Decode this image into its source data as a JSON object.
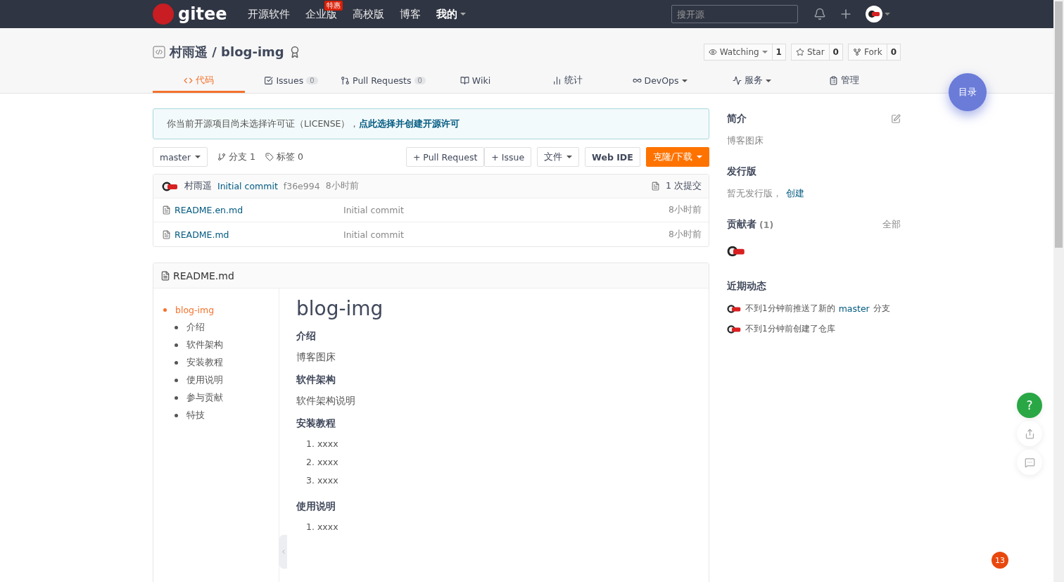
{
  "navbar": {
    "logo": "gitee",
    "links": [
      {
        "label": "开源软件"
      },
      {
        "label": "企业版",
        "badge": "特惠"
      },
      {
        "label": "高校版"
      },
      {
        "label": "博客"
      }
    ],
    "menu": "我的",
    "search": {
      "placeholder": "搜开源"
    }
  },
  "repo": {
    "title": "村雨遥 / blog-img",
    "actions": [
      {
        "label": "Watching",
        "caret": true,
        "count": "1",
        "kind": "watch"
      },
      {
        "label": "Star",
        "caret": false,
        "count": "0",
        "kind": "star"
      },
      {
        "label": "Fork",
        "caret": false,
        "count": "0",
        "kind": "fork"
      }
    ]
  },
  "tabs": [
    {
      "label": "代码",
      "kind": "code",
      "selected": true
    },
    {
      "label": "Issues",
      "count": "0",
      "kind": "issues",
      "selected": false
    },
    {
      "label": "Pull Requests",
      "count": "0",
      "kind": "pr",
      "selected": false
    },
    {
      "label": "Wiki",
      "kind": "wiki",
      "selected": false
    },
    {
      "label": "统计",
      "kind": "stats",
      "selected": false
    },
    {
      "label": "DevOps",
      "kind": "devops",
      "caret": true,
      "selected": false
    },
    {
      "label": "服务",
      "kind": "service",
      "caret": true,
      "selected": false
    },
    {
      "label": "管理",
      "kind": "admin",
      "selected": false
    }
  ],
  "notice": {
    "text": "你当前开源项目尚未选择许可证（LICENSE），",
    "link": "点此选择并创建开源许可"
  },
  "toolbar": {
    "branch": "master",
    "branches": "分支 1",
    "tags": "标签 0",
    "pull_request": "+ Pull Request",
    "issue": "+ Issue",
    "file_menu": "文件",
    "web_ide": "Web IDE",
    "clone": "克隆/下载"
  },
  "commit": {
    "author": "村雨遥",
    "message": "Initial commit",
    "hash": "f36e994",
    "time": "8小时前",
    "count": "1 次提交"
  },
  "files": [
    {
      "name": "README.en.md",
      "message": "Initial commit",
      "time": "8小时前"
    },
    {
      "name": "README.md",
      "message": "Initial commit",
      "time": "8小时前"
    }
  ],
  "readme": {
    "title": "README.md",
    "toc": [
      {
        "label": "blog-img",
        "selected": true,
        "children": [
          {
            "label": "介绍",
            "selected": false
          },
          {
            "label": "软件架构",
            "selected": false
          },
          {
            "label": "安装教程",
            "selected": false
          },
          {
            "label": "使用说明",
            "selected": false
          },
          {
            "label": "参与贡献",
            "selected": false
          },
          {
            "label": "特技",
            "selected": false
          }
        ]
      }
    ],
    "content": [
      {
        "kind": "h1",
        "text": "blog-img"
      },
      {
        "kind": "h3",
        "text": "介绍"
      },
      {
        "kind": "p",
        "text": "博客图床"
      },
      {
        "kind": "h3",
        "text": "软件架构"
      },
      {
        "kind": "p",
        "text": "软件架构说明"
      },
      {
        "kind": "h3",
        "text": "安装教程"
      },
      {
        "kind": "ol",
        "items": [
          {
            "num": "1.",
            "text": "xxxx"
          },
          {
            "num": "2.",
            "text": "xxxx"
          },
          {
            "num": "3.",
            "text": "xxxx"
          }
        ]
      },
      {
        "kind": "h3",
        "text": "使用说明"
      },
      {
        "kind": "ol",
        "items": [
          {
            "num": "1.",
            "text": "xxxx"
          }
        ]
      }
    ]
  },
  "sidebar": {
    "intro": {
      "title": "简介",
      "text": "博客图床"
    },
    "releases": {
      "title": "发行版",
      "text": "暂无发行版，",
      "link": "创建"
    },
    "contributors": {
      "title": "贡献者",
      "count": "(1)",
      "all": "全部"
    },
    "activity": {
      "title": "近期动态",
      "items": [
        {
          "text": "不到1分钟前推送了新的",
          "link": "master",
          "after": "分支"
        },
        {
          "text": "不到1分钟前创建了仓库"
        }
      ]
    }
  },
  "floating": {
    "toc": "目录",
    "help": "?",
    "badge": "13"
  }
}
